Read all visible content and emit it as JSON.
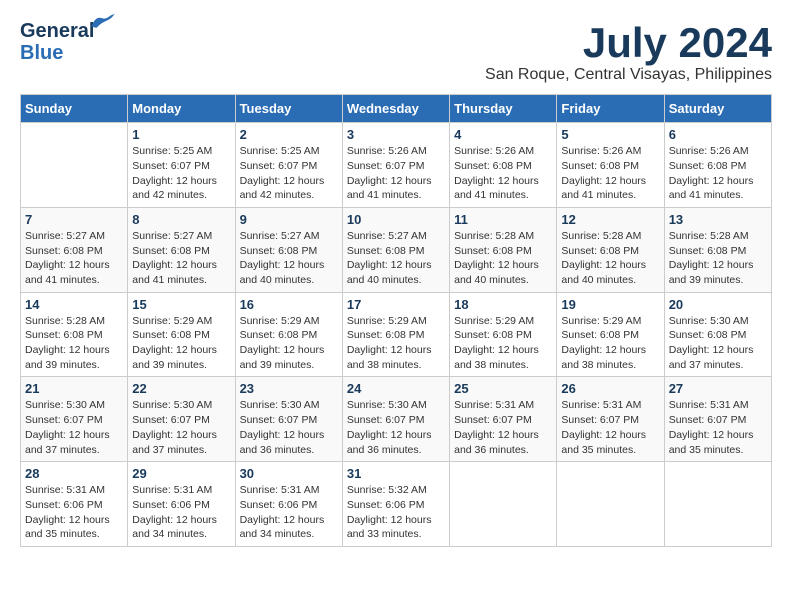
{
  "header": {
    "logo_general": "General",
    "logo_blue": "Blue",
    "month_year": "July 2024",
    "location": "San Roque, Central Visayas, Philippines"
  },
  "days_of_week": [
    "Sunday",
    "Monday",
    "Tuesday",
    "Wednesday",
    "Thursday",
    "Friday",
    "Saturday"
  ],
  "weeks": [
    [
      {
        "day": "",
        "sunrise": "",
        "sunset": "",
        "daylight": ""
      },
      {
        "day": "1",
        "sunrise": "Sunrise: 5:25 AM",
        "sunset": "Sunset: 6:07 PM",
        "daylight": "Daylight: 12 hours and 42 minutes."
      },
      {
        "day": "2",
        "sunrise": "Sunrise: 5:25 AM",
        "sunset": "Sunset: 6:07 PM",
        "daylight": "Daylight: 12 hours and 42 minutes."
      },
      {
        "day": "3",
        "sunrise": "Sunrise: 5:26 AM",
        "sunset": "Sunset: 6:07 PM",
        "daylight": "Daylight: 12 hours and 41 minutes."
      },
      {
        "day": "4",
        "sunrise": "Sunrise: 5:26 AM",
        "sunset": "Sunset: 6:08 PM",
        "daylight": "Daylight: 12 hours and 41 minutes."
      },
      {
        "day": "5",
        "sunrise": "Sunrise: 5:26 AM",
        "sunset": "Sunset: 6:08 PM",
        "daylight": "Daylight: 12 hours and 41 minutes."
      },
      {
        "day": "6",
        "sunrise": "Sunrise: 5:26 AM",
        "sunset": "Sunset: 6:08 PM",
        "daylight": "Daylight: 12 hours and 41 minutes."
      }
    ],
    [
      {
        "day": "7",
        "sunrise": "Sunrise: 5:27 AM",
        "sunset": "Sunset: 6:08 PM",
        "daylight": "Daylight: 12 hours and 41 minutes."
      },
      {
        "day": "8",
        "sunrise": "Sunrise: 5:27 AM",
        "sunset": "Sunset: 6:08 PM",
        "daylight": "Daylight: 12 hours and 41 minutes."
      },
      {
        "day": "9",
        "sunrise": "Sunrise: 5:27 AM",
        "sunset": "Sunset: 6:08 PM",
        "daylight": "Daylight: 12 hours and 40 minutes."
      },
      {
        "day": "10",
        "sunrise": "Sunrise: 5:27 AM",
        "sunset": "Sunset: 6:08 PM",
        "daylight": "Daylight: 12 hours and 40 minutes."
      },
      {
        "day": "11",
        "sunrise": "Sunrise: 5:28 AM",
        "sunset": "Sunset: 6:08 PM",
        "daylight": "Daylight: 12 hours and 40 minutes."
      },
      {
        "day": "12",
        "sunrise": "Sunrise: 5:28 AM",
        "sunset": "Sunset: 6:08 PM",
        "daylight": "Daylight: 12 hours and 40 minutes."
      },
      {
        "day": "13",
        "sunrise": "Sunrise: 5:28 AM",
        "sunset": "Sunset: 6:08 PM",
        "daylight": "Daylight: 12 hours and 39 minutes."
      }
    ],
    [
      {
        "day": "14",
        "sunrise": "Sunrise: 5:28 AM",
        "sunset": "Sunset: 6:08 PM",
        "daylight": "Daylight: 12 hours and 39 minutes."
      },
      {
        "day": "15",
        "sunrise": "Sunrise: 5:29 AM",
        "sunset": "Sunset: 6:08 PM",
        "daylight": "Daylight: 12 hours and 39 minutes."
      },
      {
        "day": "16",
        "sunrise": "Sunrise: 5:29 AM",
        "sunset": "Sunset: 6:08 PM",
        "daylight": "Daylight: 12 hours and 39 minutes."
      },
      {
        "day": "17",
        "sunrise": "Sunrise: 5:29 AM",
        "sunset": "Sunset: 6:08 PM",
        "daylight": "Daylight: 12 hours and 38 minutes."
      },
      {
        "day": "18",
        "sunrise": "Sunrise: 5:29 AM",
        "sunset": "Sunset: 6:08 PM",
        "daylight": "Daylight: 12 hours and 38 minutes."
      },
      {
        "day": "19",
        "sunrise": "Sunrise: 5:29 AM",
        "sunset": "Sunset: 6:08 PM",
        "daylight": "Daylight: 12 hours and 38 minutes."
      },
      {
        "day": "20",
        "sunrise": "Sunrise: 5:30 AM",
        "sunset": "Sunset: 6:08 PM",
        "daylight": "Daylight: 12 hours and 37 minutes."
      }
    ],
    [
      {
        "day": "21",
        "sunrise": "Sunrise: 5:30 AM",
        "sunset": "Sunset: 6:07 PM",
        "daylight": "Daylight: 12 hours and 37 minutes."
      },
      {
        "day": "22",
        "sunrise": "Sunrise: 5:30 AM",
        "sunset": "Sunset: 6:07 PM",
        "daylight": "Daylight: 12 hours and 37 minutes."
      },
      {
        "day": "23",
        "sunrise": "Sunrise: 5:30 AM",
        "sunset": "Sunset: 6:07 PM",
        "daylight": "Daylight: 12 hours and 36 minutes."
      },
      {
        "day": "24",
        "sunrise": "Sunrise: 5:30 AM",
        "sunset": "Sunset: 6:07 PM",
        "daylight": "Daylight: 12 hours and 36 minutes."
      },
      {
        "day": "25",
        "sunrise": "Sunrise: 5:31 AM",
        "sunset": "Sunset: 6:07 PM",
        "daylight": "Daylight: 12 hours and 36 minutes."
      },
      {
        "day": "26",
        "sunrise": "Sunrise: 5:31 AM",
        "sunset": "Sunset: 6:07 PM",
        "daylight": "Daylight: 12 hours and 35 minutes."
      },
      {
        "day": "27",
        "sunrise": "Sunrise: 5:31 AM",
        "sunset": "Sunset: 6:07 PM",
        "daylight": "Daylight: 12 hours and 35 minutes."
      }
    ],
    [
      {
        "day": "28",
        "sunrise": "Sunrise: 5:31 AM",
        "sunset": "Sunset: 6:06 PM",
        "daylight": "Daylight: 12 hours and 35 minutes."
      },
      {
        "day": "29",
        "sunrise": "Sunrise: 5:31 AM",
        "sunset": "Sunset: 6:06 PM",
        "daylight": "Daylight: 12 hours and 34 minutes."
      },
      {
        "day": "30",
        "sunrise": "Sunrise: 5:31 AM",
        "sunset": "Sunset: 6:06 PM",
        "daylight": "Daylight: 12 hours and 34 minutes."
      },
      {
        "day": "31",
        "sunrise": "Sunrise: 5:32 AM",
        "sunset": "Sunset: 6:06 PM",
        "daylight": "Daylight: 12 hours and 33 minutes."
      },
      {
        "day": "",
        "sunrise": "",
        "sunset": "",
        "daylight": ""
      },
      {
        "day": "",
        "sunrise": "",
        "sunset": "",
        "daylight": ""
      },
      {
        "day": "",
        "sunrise": "",
        "sunset": "",
        "daylight": ""
      }
    ]
  ]
}
